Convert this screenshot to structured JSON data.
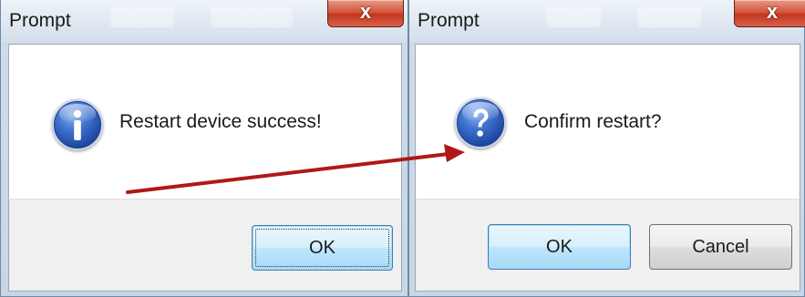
{
  "left_dialog": {
    "title": "Prompt",
    "close_label": "x",
    "icon": "info-icon",
    "message": "Restart device success!",
    "ok_label": "OK"
  },
  "right_dialog": {
    "title": "Prompt",
    "close_label": "x",
    "icon": "question-icon",
    "message": "Confirm restart?",
    "ok_label": "OK",
    "cancel_label": "Cancel"
  },
  "colors": {
    "arrow": "#b01818",
    "close_button": "#c94a30",
    "icon_blue": "#2a58b8",
    "default_button_border": "#3c7fb1"
  }
}
